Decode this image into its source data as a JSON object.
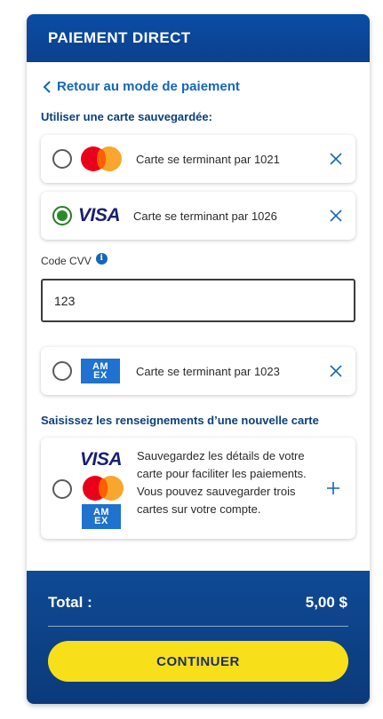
{
  "header": {
    "title": "PAIEMENT DIRECT"
  },
  "back_link": {
    "label": "Retour au mode de paiement"
  },
  "saved_section": {
    "label": "Utiliser une carte sauvegardée:"
  },
  "saved_cards": [
    {
      "brand": "mastercard",
      "text": "Carte se terminant par 1021",
      "selected": false
    },
    {
      "brand": "visa",
      "text": "Carte se terminant par 1026",
      "selected": true
    },
    {
      "brand": "amex",
      "text": "Carte se terminant par 1023",
      "selected": false
    }
  ],
  "logos": {
    "visa": "VISA",
    "amex_line1": "AM",
    "amex_line2": "EX"
  },
  "cvv": {
    "label": "Code CVV",
    "info_icon": "i",
    "value": "123"
  },
  "new_card_section": {
    "label": "Saisissez les renseignements d’une nouvelle carte"
  },
  "new_card": {
    "text": "Sauvegardez les détails de votre carte pour faciliter les paiements. Vous pouvez sauvegarder trois cartes sur votre compte."
  },
  "footer": {
    "total_label": "Total :",
    "total_value": "5,00 $",
    "continue_label": "CONTINUER"
  },
  "colors": {
    "header_blue": "#0a4da6",
    "accent_blue": "#1466b8",
    "selected_green": "#2a8a2a",
    "continue_yellow": "#f7e01a"
  }
}
